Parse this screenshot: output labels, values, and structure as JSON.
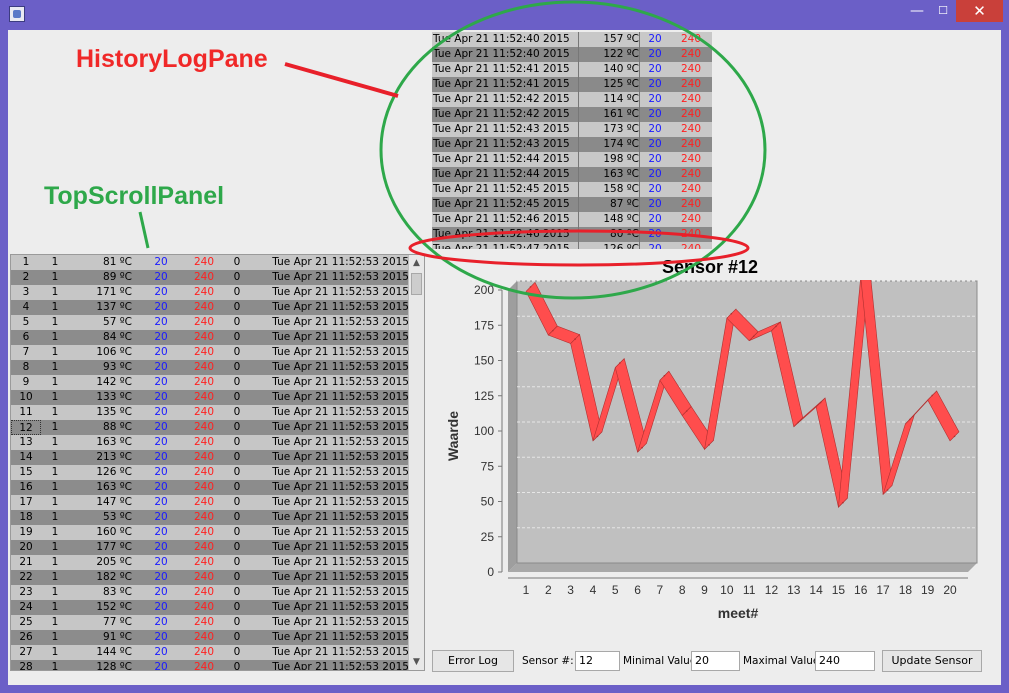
{
  "window": {
    "close_glyph": "✕",
    "max_glyph": "☐",
    "min_glyph": "—"
  },
  "annotations": {
    "history": "HistoryLogPane",
    "top": "TopScrollPanel"
  },
  "history_log": [
    {
      "date": "Tue Apr 21 11:52:40 2015",
      "value": "157 ºC",
      "min": "20",
      "max": "240"
    },
    {
      "date": "Tue Apr 21 11:52:40 2015",
      "value": "122 ºC",
      "min": "20",
      "max": "240"
    },
    {
      "date": "Tue Apr 21 11:52:41 2015",
      "value": "140 ºC",
      "min": "20",
      "max": "240"
    },
    {
      "date": "Tue Apr 21 11:52:41 2015",
      "value": "125 ºC",
      "min": "20",
      "max": "240"
    },
    {
      "date": "Tue Apr 21 11:52:42 2015",
      "value": "114 ºC",
      "min": "20",
      "max": "240"
    },
    {
      "date": "Tue Apr 21 11:52:42 2015",
      "value": "161 ºC",
      "min": "20",
      "max": "240"
    },
    {
      "date": "Tue Apr 21 11:52:43 2015",
      "value": "173 ºC",
      "min": "20",
      "max": "240"
    },
    {
      "date": "Tue Apr 21 11:52:43 2015",
      "value": "174 ºC",
      "min": "20",
      "max": "240"
    },
    {
      "date": "Tue Apr 21 11:52:44 2015",
      "value": "198 ºC",
      "min": "20",
      "max": "240"
    },
    {
      "date": "Tue Apr 21 11:52:44 2015",
      "value": "163 ºC",
      "min": "20",
      "max": "240"
    },
    {
      "date": "Tue Apr 21 11:52:45 2015",
      "value": "158 ºC",
      "min": "20",
      "max": "240"
    },
    {
      "date": "Tue Apr 21 11:52:45 2015",
      "value": "87 ºC",
      "min": "20",
      "max": "240"
    },
    {
      "date": "Tue Apr 21 11:52:46 2015",
      "value": "148 ºC",
      "min": "20",
      "max": "240"
    },
    {
      "date": "Tue Apr 21 11:52:46 2015",
      "value": "80 ºC",
      "min": "20",
      "max": "240"
    },
    {
      "date": "Tue Apr 21 11:52:47 2015",
      "value": "126 ºC",
      "min": "20",
      "max": "240"
    }
  ],
  "top_panel": {
    "rows": [
      {
        "idx": "1",
        "sensor": "1",
        "value": "81 ºC",
        "min": "20",
        "max": "240",
        "err": "0",
        "date": "Tue Apr 21 11:52:53 2015"
      },
      {
        "idx": "2",
        "sensor": "1",
        "value": "89 ºC",
        "min": "20",
        "max": "240",
        "err": "0",
        "date": "Tue Apr 21 11:52:53 2015"
      },
      {
        "idx": "3",
        "sensor": "1",
        "value": "171 ºC",
        "min": "20",
        "max": "240",
        "err": "0",
        "date": "Tue Apr 21 11:52:53 2015"
      },
      {
        "idx": "4",
        "sensor": "1",
        "value": "137 ºC",
        "min": "20",
        "max": "240",
        "err": "0",
        "date": "Tue Apr 21 11:52:53 2015"
      },
      {
        "idx": "5",
        "sensor": "1",
        "value": "57 ºC",
        "min": "20",
        "max": "240",
        "err": "0",
        "date": "Tue Apr 21 11:52:53 2015"
      },
      {
        "idx": "6",
        "sensor": "1",
        "value": "84 ºC",
        "min": "20",
        "max": "240",
        "err": "0",
        "date": "Tue Apr 21 11:52:53 2015"
      },
      {
        "idx": "7",
        "sensor": "1",
        "value": "106 ºC",
        "min": "20",
        "max": "240",
        "err": "0",
        "date": "Tue Apr 21 11:52:53 2015"
      },
      {
        "idx": "8",
        "sensor": "1",
        "value": "93 ºC",
        "min": "20",
        "max": "240",
        "err": "0",
        "date": "Tue Apr 21 11:52:53 2015"
      },
      {
        "idx": "9",
        "sensor": "1",
        "value": "142 ºC",
        "min": "20",
        "max": "240",
        "err": "0",
        "date": "Tue Apr 21 11:52:53 2015"
      },
      {
        "idx": "10",
        "sensor": "1",
        "value": "133 ºC",
        "min": "20",
        "max": "240",
        "err": "0",
        "date": "Tue Apr 21 11:52:53 2015"
      },
      {
        "idx": "11",
        "sensor": "1",
        "value": "135 ºC",
        "min": "20",
        "max": "240",
        "err": "0",
        "date": "Tue Apr 21 11:52:53 2015"
      },
      {
        "idx": "12",
        "sensor": "1",
        "value": "88 ºC",
        "min": "20",
        "max": "240",
        "err": "0",
        "date": "Tue Apr 21 11:52:53 2015"
      },
      {
        "idx": "13",
        "sensor": "1",
        "value": "163 ºC",
        "min": "20",
        "max": "240",
        "err": "0",
        "date": "Tue Apr 21 11:52:53 2015"
      },
      {
        "idx": "14",
        "sensor": "1",
        "value": "213 ºC",
        "min": "20",
        "max": "240",
        "err": "0",
        "date": "Tue Apr 21 11:52:53 2015"
      },
      {
        "idx": "15",
        "sensor": "1",
        "value": "126 ºC",
        "min": "20",
        "max": "240",
        "err": "0",
        "date": "Tue Apr 21 11:52:53 2015"
      },
      {
        "idx": "16",
        "sensor": "1",
        "value": "163 ºC",
        "min": "20",
        "max": "240",
        "err": "0",
        "date": "Tue Apr 21 11:52:53 2015"
      },
      {
        "idx": "17",
        "sensor": "1",
        "value": "147 ºC",
        "min": "20",
        "max": "240",
        "err": "0",
        "date": "Tue Apr 21 11:52:53 2015"
      },
      {
        "idx": "18",
        "sensor": "1",
        "value": "53 ºC",
        "min": "20",
        "max": "240",
        "err": "0",
        "date": "Tue Apr 21 11:52:53 2015"
      },
      {
        "idx": "19",
        "sensor": "1",
        "value": "160 ºC",
        "min": "20",
        "max": "240",
        "err": "0",
        "date": "Tue Apr 21 11:52:53 2015"
      },
      {
        "idx": "20",
        "sensor": "1",
        "value": "177 ºC",
        "min": "20",
        "max": "240",
        "err": "0",
        "date": "Tue Apr 21 11:52:53 2015"
      },
      {
        "idx": "21",
        "sensor": "1",
        "value": "205 ºC",
        "min": "20",
        "max": "240",
        "err": "0",
        "date": "Tue Apr 21 11:52:53 2015"
      },
      {
        "idx": "22",
        "sensor": "1",
        "value": "182 ºC",
        "min": "20",
        "max": "240",
        "err": "0",
        "date": "Tue Apr 21 11:52:53 2015"
      },
      {
        "idx": "23",
        "sensor": "1",
        "value": "83 ºC",
        "min": "20",
        "max": "240",
        "err": "0",
        "date": "Tue Apr 21 11:52:53 2015"
      },
      {
        "idx": "24",
        "sensor": "1",
        "value": "152 ºC",
        "min": "20",
        "max": "240",
        "err": "0",
        "date": "Tue Apr 21 11:52:53 2015"
      },
      {
        "idx": "25",
        "sensor": "1",
        "value": "77 ºC",
        "min": "20",
        "max": "240",
        "err": "0",
        "date": "Tue Apr 21 11:52:53 2015"
      },
      {
        "idx": "26",
        "sensor": "1",
        "value": "91 ºC",
        "min": "20",
        "max": "240",
        "err": "0",
        "date": "Tue Apr 21 11:52:53 2015"
      },
      {
        "idx": "27",
        "sensor": "1",
        "value": "144 ºC",
        "min": "20",
        "max": "240",
        "err": "0",
        "date": "Tue Apr 21 11:52:53 2015"
      },
      {
        "idx": "28",
        "sensor": "1",
        "value": "128 ºC",
        "min": "20",
        "max": "240",
        "err": "0",
        "date": "Tue Apr 21 11:52:53 2015"
      }
    ],
    "selected_index": 11
  },
  "chart_data": {
    "type": "line",
    "title": "Sensor #12",
    "xlabel": "meet#",
    "ylabel": "Waarde",
    "x": [
      1,
      2,
      3,
      4,
      5,
      6,
      7,
      8,
      9,
      10,
      11,
      12,
      13,
      14,
      15,
      16,
      17,
      18,
      19,
      20
    ],
    "series": [
      {
        "values": [
          199,
          168,
          162,
          93,
          145,
          85,
          136,
          111,
          87,
          180,
          164,
          171,
          103,
          117,
          46,
          209,
          55,
          105,
          122,
          93
        ]
      }
    ],
    "ylim": [
      0,
      200
    ],
    "yticks": [
      0,
      25,
      50,
      75,
      100,
      125,
      150,
      175,
      200
    ],
    "grid": true,
    "colors": {
      "line": "#ff4d4d",
      "plot_bg": "#c0c0c0",
      "grid": "#e6e6e6"
    }
  },
  "bottom_bar": {
    "error_log_label": "Error Log",
    "sensor_label": "Sensor #:",
    "sensor_value": "12",
    "min_label": "Minimal Value",
    "min_value": "20",
    "max_label": "Maximal Value",
    "max_value": "240",
    "update_label": "Update Sensor"
  },
  "colors": {
    "min_text": "#1a1aff",
    "max_text": "#ff2020",
    "window_frame": "#6b5fc7"
  }
}
